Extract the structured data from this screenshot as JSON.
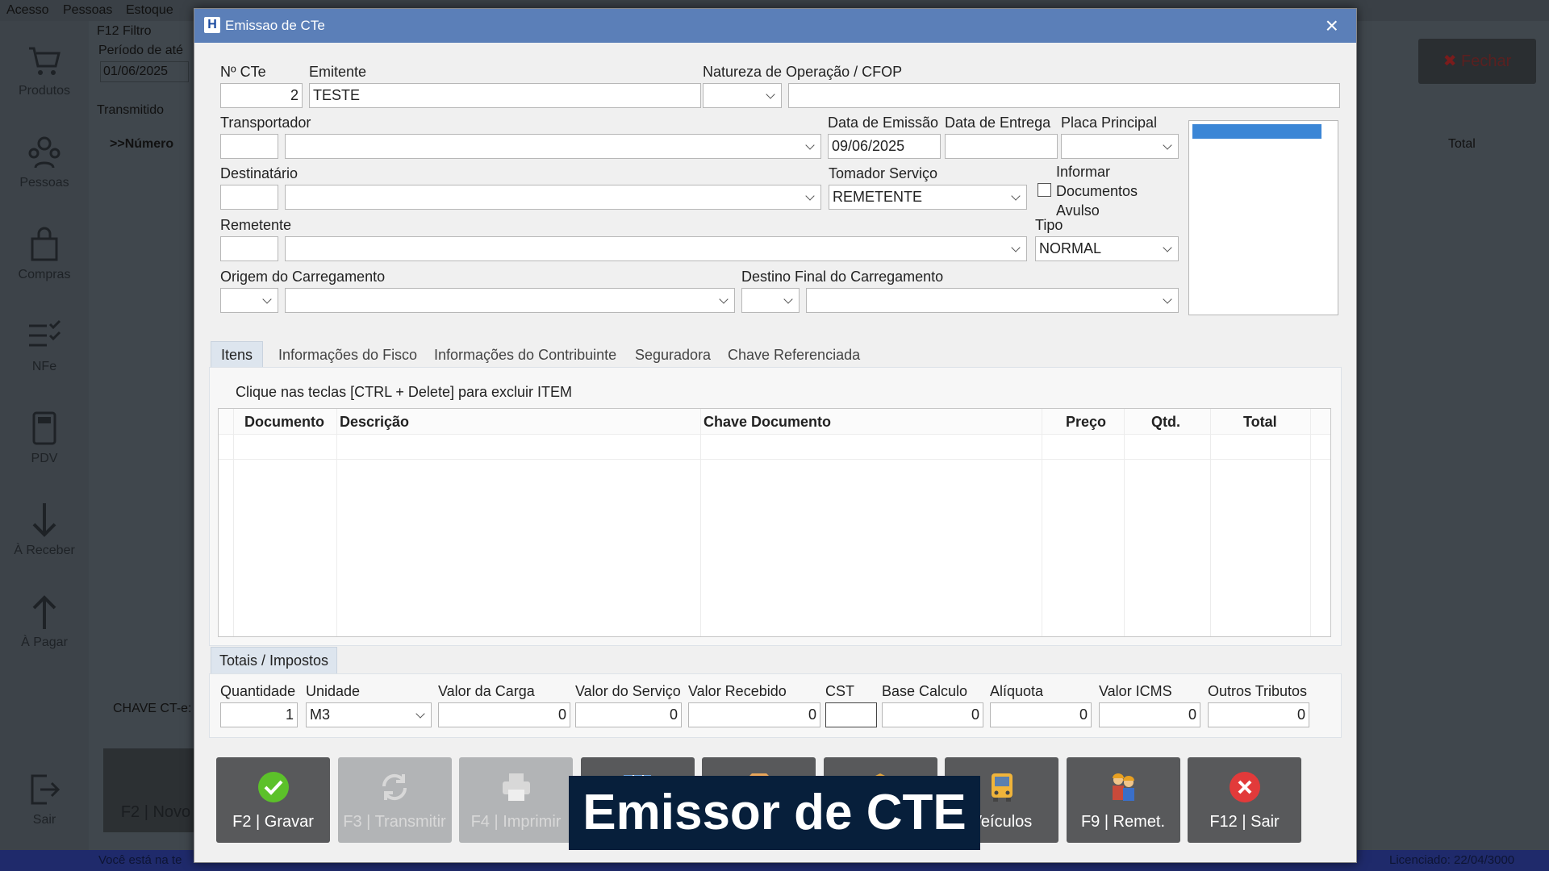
{
  "background": {
    "menu": [
      "Acesso",
      "Pessoas",
      "Estoque"
    ],
    "filter_label": "F12 Filtro",
    "period_label": "Período de até",
    "period_value": "01/06/2025",
    "tab_transmitido": "Transmitido",
    "col_numero": ">>Número",
    "col_total": "Total",
    "chave_label": "CHAVE CT-e:",
    "fechar_label": "Fechar",
    "novo_label": "F2 | Novo",
    "status_left": "Você está na te",
    "status_right": "Licenciado: 22/04/3000",
    "sidebar": [
      {
        "icon": "cart-icon",
        "label": "Produtos"
      },
      {
        "icon": "people-icon",
        "label": "Pessoas"
      },
      {
        "icon": "shopping-bag-icon",
        "label": "Compras"
      },
      {
        "icon": "checklist-icon",
        "label": "NFe"
      },
      {
        "icon": "pos-terminal-icon",
        "label": "PDV"
      },
      {
        "icon": "arrow-down-icon",
        "label": "À Receber"
      },
      {
        "icon": "arrow-up-icon",
        "label": "À Pagar"
      },
      {
        "icon": "exit-icon",
        "label": "Sair"
      }
    ]
  },
  "modal": {
    "title": "Emissao de CTe",
    "logo_letter": "H",
    "close": "×",
    "fields": {
      "num_cte_label": "Nº CTe",
      "num_cte_value": "2",
      "emitente_label": "Emitente",
      "emitente_value": "TESTE",
      "natureza_label": "Natureza de Operação / CFOP",
      "transportador_label": "Transportador",
      "data_emissao_label": "Data de Emissão",
      "data_emissao_value": "09/06/2025",
      "data_entrega_label": "Data de Entrega",
      "placa_label": "Placa Principal",
      "destinatario_label": "Destinatário",
      "tomador_label": "Tomador Serviço",
      "tomador_value": "REMETENTE",
      "informar_label_1": "Informar",
      "informar_label_2": "Documentos",
      "informar_label_3": "Avulso",
      "remetente_label": "Remetente",
      "tipo_label": "Tipo",
      "tipo_value": "NORMAL",
      "origem_label": "Origem do Carregamento",
      "destino_label": "Destino Final do Carregamento"
    },
    "tabs": [
      "Itens",
      "Informações do Fisco",
      "Informações do Contribuinte",
      "Seguradora",
      "Chave Referenciada"
    ],
    "items_hint": "Clique nas teclas [CTRL + Delete] para excluir ITEM",
    "grid_columns": [
      "Documento",
      "Descrição",
      "Chave Documento",
      "Preço",
      "Qtd.",
      "Total"
    ],
    "totals_tab": "Totais / Impostos",
    "totals": [
      {
        "label": "Quantidade",
        "value": "1"
      },
      {
        "label": "Unidade",
        "value": "M3"
      },
      {
        "label": "Valor da Carga",
        "value": "0"
      },
      {
        "label": "Valor do Serviço",
        "value": "0"
      },
      {
        "label": "Valor Recebido",
        "value": "0"
      },
      {
        "label": "CST",
        "value": ""
      },
      {
        "label": "Base Calculo",
        "value": "0"
      },
      {
        "label": "Alíquota",
        "value": "0"
      },
      {
        "label": "Valor ICMS",
        "value": "0"
      },
      {
        "label": "Outros Tributos",
        "value": "0"
      }
    ],
    "buttons": [
      {
        "label": "F2 | Gravar",
        "icon": "check-circle-icon",
        "enabled": true
      },
      {
        "label": "F3 | Transmitir",
        "icon": "sync-icon",
        "enabled": false
      },
      {
        "label": "F4 | Imprimir",
        "icon": "printer-icon",
        "enabled": false
      },
      {
        "label": "",
        "icon": "table-icon",
        "enabled": true
      },
      {
        "label": "",
        "icon": "box-icon",
        "enabled": true
      },
      {
        "label": "",
        "icon": "package-icon",
        "enabled": true
      },
      {
        "label": "Veículos",
        "icon": "bus-icon",
        "enabled": true
      },
      {
        "label": "F9 | Remet.",
        "icon": "workers-icon",
        "enabled": true
      },
      {
        "label": "F12 | Sair",
        "icon": "close-circle-icon",
        "enabled": true
      }
    ]
  },
  "caption": "Emissor de CTE",
  "colors": {
    "titlebar": "#5b7fb8",
    "button": "#58595b",
    "button_disabled": "#b2b4b6",
    "caption_bg": "#071f3b",
    "list_highlight": "#3b86d6"
  }
}
